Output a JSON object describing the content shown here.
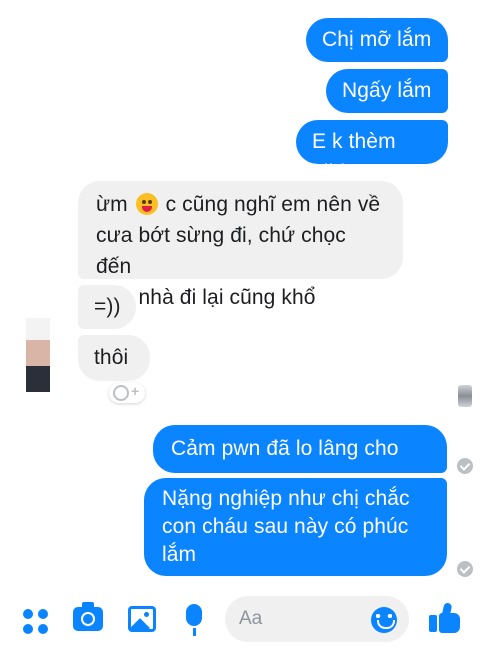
{
  "conversation": {
    "messages": [
      {
        "sender": "me",
        "text": "Chị mỡ lắm"
      },
      {
        "sender": "me",
        "text": "Ngấy lắm"
      },
      {
        "sender": "me",
        "text": "E k thèm hihi"
      },
      {
        "sender": "them",
        "text_before_emoji": "ừm",
        "emoji": "tongue-out-emoji",
        "text_after_emoji": "c cũng nghĩ em nên về\ncưa bớt sừng đi, chứ chọc đến\ntrần nhà đi lại cũng khổ"
      },
      {
        "sender": "them",
        "text": "=))"
      },
      {
        "sender": "them",
        "text": "thôi"
      },
      {
        "sender": "me",
        "text": "Cảm pwn đã lo lâng cho em"
      },
      {
        "sender": "me",
        "text": "Nặng nghiệp như chị chắc\ncon cháu sau này có phúc\nlắm"
      }
    ]
  },
  "composer": {
    "placeholder": "Aa",
    "icons": [
      "more-apps-icon",
      "camera-icon",
      "gallery-icon",
      "microphone-icon",
      "emoji-icon",
      "like-icon"
    ]
  },
  "colors": {
    "outgoing_bubble": "#0a84ff",
    "incoming_bubble": "#f1f0f0",
    "accent": "#0a84ff"
  }
}
